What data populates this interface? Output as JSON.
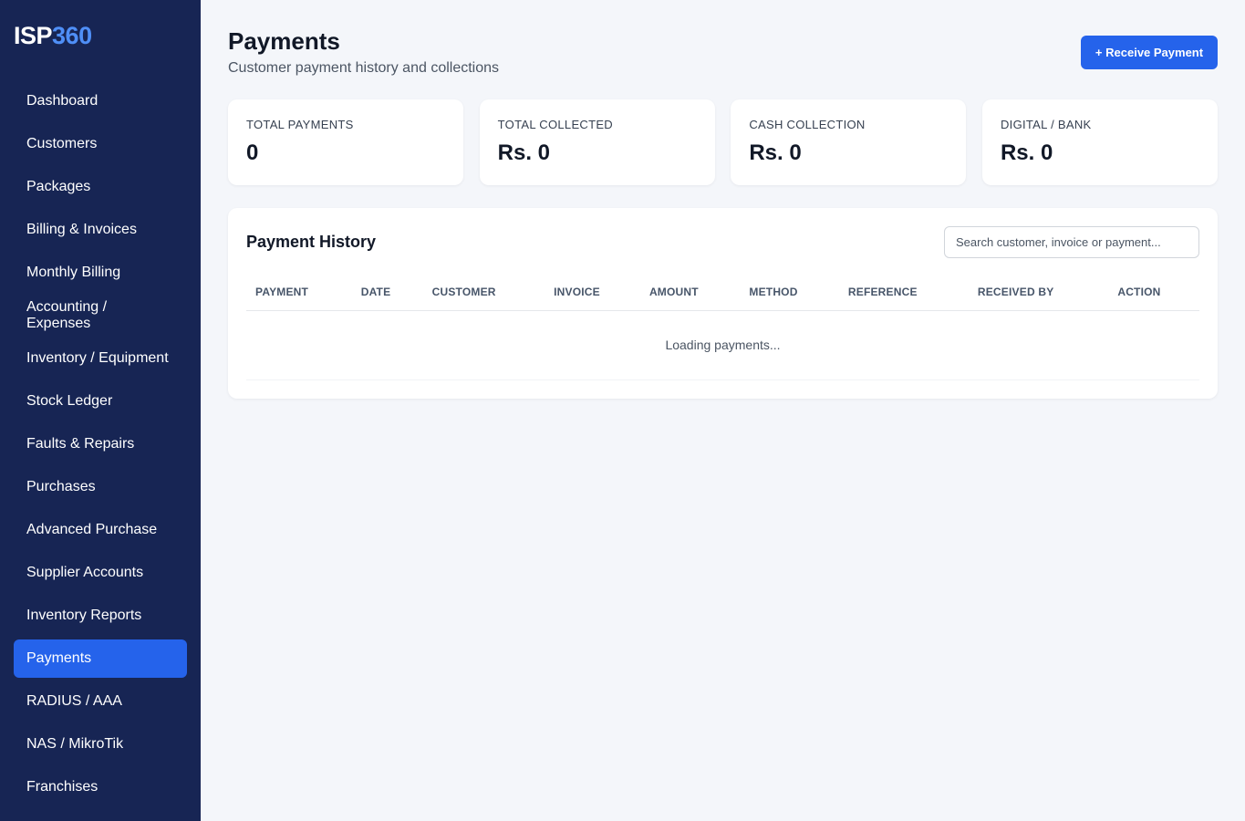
{
  "brand": {
    "part1": "ISP",
    "part2": "360"
  },
  "sidebar": {
    "items": [
      {
        "label": "Dashboard",
        "name": "dashboard"
      },
      {
        "label": "Customers",
        "name": "customers"
      },
      {
        "label": "Packages",
        "name": "packages"
      },
      {
        "label": "Billing & Invoices",
        "name": "billing-invoices"
      },
      {
        "label": "Monthly Billing",
        "name": "monthly-billing"
      },
      {
        "label": "Accounting / Expenses",
        "name": "accounting-expenses"
      },
      {
        "label": "Inventory / Equipment",
        "name": "inventory-equipment"
      },
      {
        "label": "Stock Ledger",
        "name": "stock-ledger"
      },
      {
        "label": "Faults & Repairs",
        "name": "faults-repairs"
      },
      {
        "label": "Purchases",
        "name": "purchases"
      },
      {
        "label": "Advanced Purchase",
        "name": "advanced-purchase"
      },
      {
        "label": "Supplier Accounts",
        "name": "supplier-accounts"
      },
      {
        "label": "Inventory Reports",
        "name": "inventory-reports"
      },
      {
        "label": "Payments",
        "name": "payments",
        "active": true
      },
      {
        "label": "RADIUS / AAA",
        "name": "radius-aaa"
      },
      {
        "label": "NAS / MikroTik",
        "name": "nas-mikrotik"
      },
      {
        "label": "Franchises",
        "name": "franchises"
      }
    ]
  },
  "header": {
    "title": "Payments",
    "subtitle": "Customer payment history and collections",
    "receive_button": "+ Receive Payment"
  },
  "stats": [
    {
      "label": "TOTAL PAYMENTS",
      "value": "0",
      "name": "total-payments"
    },
    {
      "label": "TOTAL COLLECTED",
      "value": "Rs. 0",
      "name": "total-collected"
    },
    {
      "label": "CASH COLLECTION",
      "value": "Rs. 0",
      "name": "cash-collection"
    },
    {
      "label": "DIGITAL / BANK",
      "value": "Rs. 0",
      "name": "digital-bank"
    }
  ],
  "history": {
    "title": "Payment History",
    "search_placeholder": "Search customer, invoice or payment...",
    "columns": [
      "PAYMENT",
      "DATE",
      "CUSTOMER",
      "INVOICE",
      "AMOUNT",
      "METHOD",
      "REFERENCE",
      "RECEIVED BY",
      "ACTION"
    ],
    "loading_text": "Loading payments..."
  },
  "colors": {
    "sidebar_bg": "#172554",
    "accent": "#2563eb",
    "page_bg": "#f4f6fa"
  }
}
